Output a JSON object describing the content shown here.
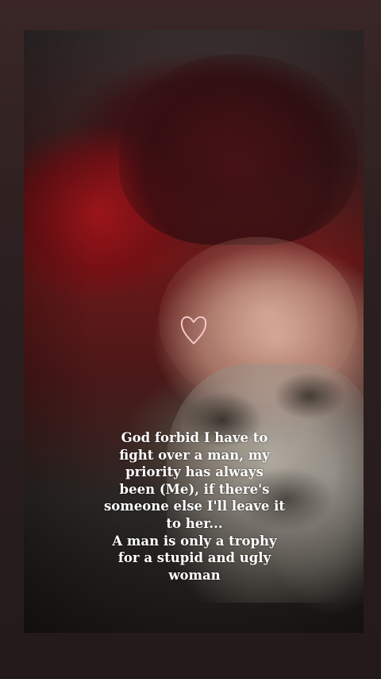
{
  "story": {
    "caption_lines": [
      "God forbid I have to",
      "fight over a man, my",
      "priority has always",
      "been (Me), if there's",
      "someone else I'll leave it",
      "to her...",
      "A man is only a trophy",
      "for a stupid and ugly",
      "woman"
    ],
    "sticker": "heart-icon"
  },
  "colors": {
    "background": "#2a1d1d",
    "caption_text": "#ffffff",
    "heart_stroke": "#f3c9c9"
  }
}
